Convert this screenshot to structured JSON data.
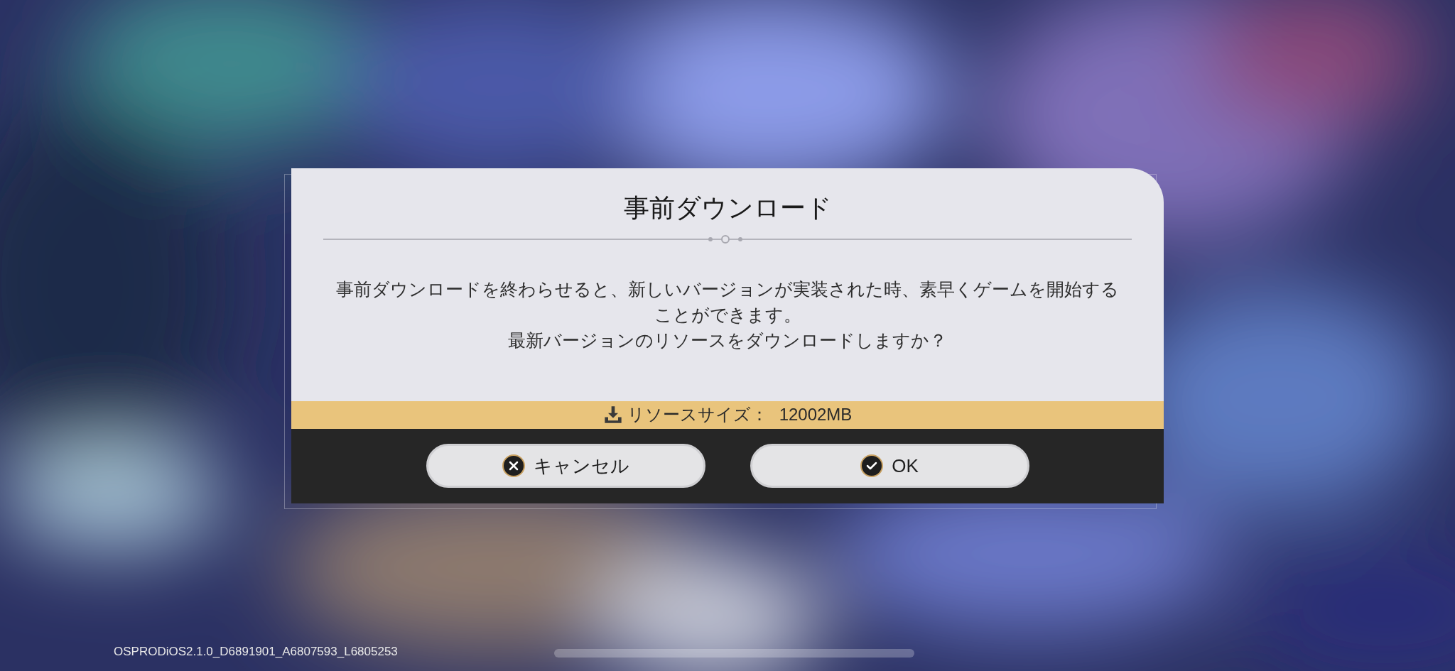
{
  "dialog": {
    "title": "事前ダウンロード",
    "message": [
      "事前ダウンロードを終わらせると、新しいバージョンが実装された時、素早くゲームを開始することができます。",
      "最新バージョンのリソースをダウンロードしますか？"
    ],
    "resource_label": "リソースサイズ：",
    "resource_value": "12002MB",
    "buttons": [
      {
        "label": "キャンセル",
        "kind": "cancel"
      },
      {
        "label": "OK",
        "kind": "confirm"
      }
    ]
  },
  "build_info": "OSPRODiOS2.1.0_D6891901_A6807593_L6805253"
}
